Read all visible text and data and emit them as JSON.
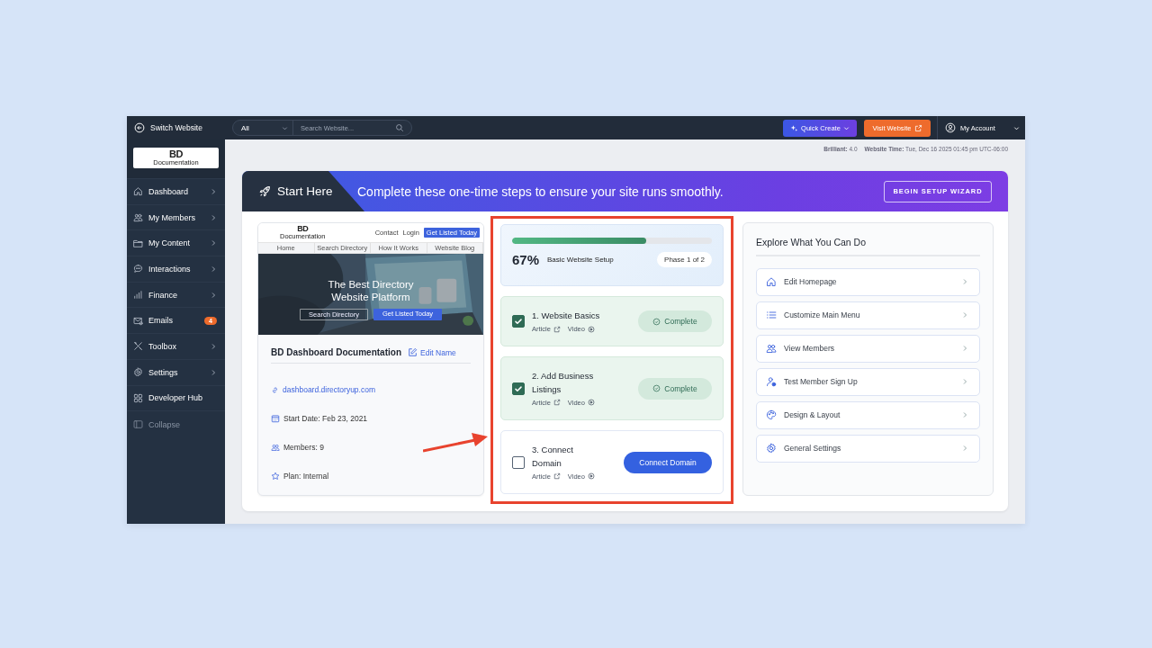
{
  "topbar": {
    "switch_label": "Switch Website",
    "filter": "All",
    "search_placeholder": "Search Website...",
    "quick_create": "Quick Create",
    "visit_website": "Visit Website",
    "account": "My Account"
  },
  "sidebar": {
    "logo": "BD",
    "logo_sub": "Documentation",
    "items": [
      {
        "label": "Dashboard",
        "kind": "menu",
        "submenu": true
      },
      {
        "label": "My Members",
        "kind": "menu",
        "submenu": true
      },
      {
        "label": "My Content",
        "kind": "menu",
        "submenu": true
      },
      {
        "label": "Interactions",
        "kind": "menu",
        "submenu": true
      },
      {
        "label": "Finance",
        "kind": "menu",
        "submenu": true
      },
      {
        "label": "Emails",
        "kind": "menu",
        "submenu": false,
        "badge": "4"
      },
      {
        "label": "Toolbox",
        "kind": "menu",
        "submenu": true
      },
      {
        "label": "Settings",
        "kind": "menu",
        "submenu": true
      },
      {
        "label": "Developer Hub",
        "kind": "menu",
        "submenu": false
      },
      {
        "label": "Collapse",
        "kind": "toggle",
        "submenu": false
      }
    ]
  },
  "status": {
    "version_label": "Brilliant:",
    "version": "4.0",
    "time_label": "Website Time:",
    "time": "Tue, Dec 16 2025 01:45 pm UTC-06:00"
  },
  "banner": {
    "title": "Start Here",
    "message": "Complete these one-time steps to ensure your site runs smoothly.",
    "button": "BEGIN SETUP WIZARD"
  },
  "site": {
    "preview": {
      "logo": "BD",
      "logo_sub": "Documentation",
      "header_links": [
        "Contact",
        "Login"
      ],
      "header_button": "Get Listed Today",
      "nav": [
        "Home",
        "Search Directory",
        "How It Works",
        "Website Blog"
      ],
      "hero_title": "The Best Directory Website Platform",
      "hero_buttons": [
        "Search Directory",
        "Get Listed Today"
      ]
    },
    "name": "BD Dashboard Documentation",
    "edit": "Edit Name",
    "url": "dashboard.directoryup.com",
    "details": [
      {
        "label": "Start Date:",
        "value": "Feb 23, 2021"
      },
      {
        "label": "Members:",
        "value": "9"
      },
      {
        "label": "Plan:",
        "value": "Internal"
      }
    ]
  },
  "setup": {
    "percent": "67%",
    "level": 0.67,
    "label": "Basic Website Setup",
    "phase": "Phase 1 of 2",
    "steps": [
      {
        "title": "1. Website Basics",
        "checked": true,
        "article": "Article",
        "video": "Video",
        "action": "Complete"
      },
      {
        "title": "2. Add Business Listings",
        "checked": true,
        "article": "Article",
        "video": "Video",
        "action": "Complete"
      },
      {
        "title": "3. Connect Domain",
        "checked": false,
        "article": "Article",
        "video": "Video",
        "action": "Connect Domain"
      }
    ]
  },
  "explore": {
    "title": "Explore What You Can Do",
    "items": [
      "Edit Homepage",
      "Customize Main Menu",
      "View Members",
      "Test Member Sign Up",
      "Design & Layout",
      "General Settings"
    ]
  }
}
